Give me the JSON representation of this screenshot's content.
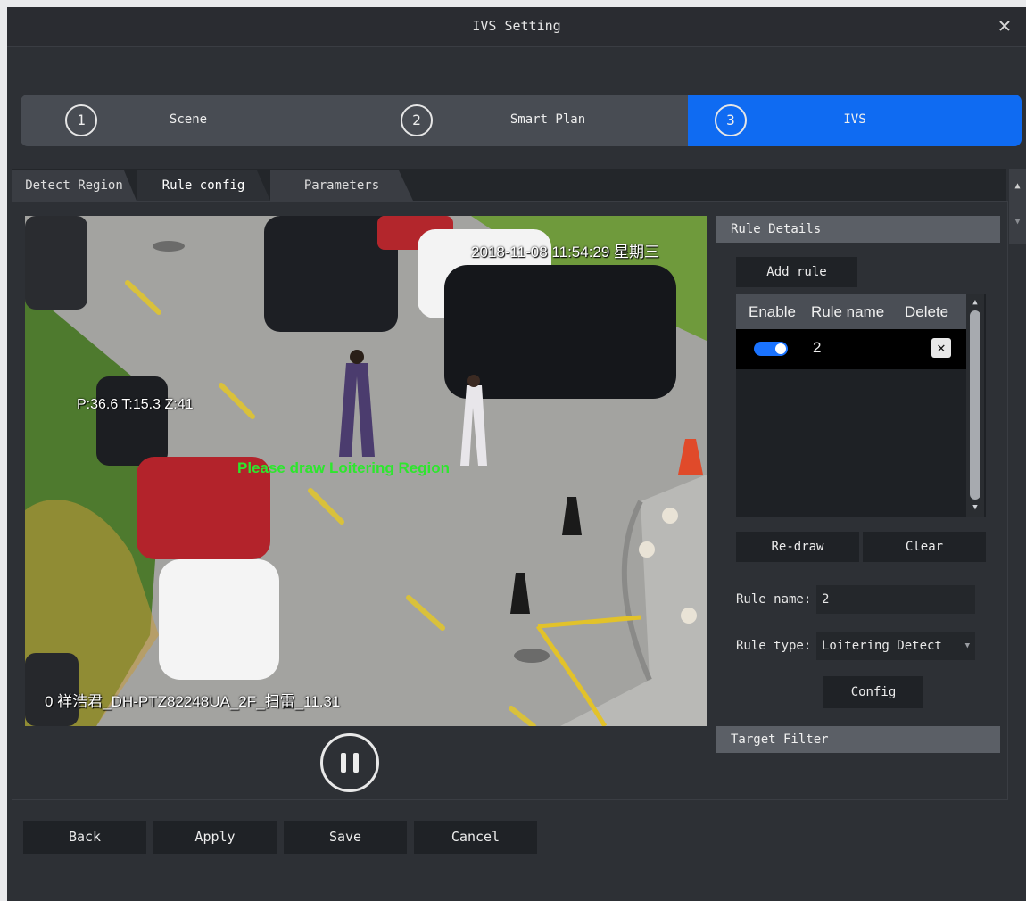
{
  "window": {
    "title": "IVS Setting",
    "close_glyph": "✕"
  },
  "steps": [
    {
      "number": "1",
      "label": "Scene",
      "active": false
    },
    {
      "number": "2",
      "label": "Smart Plan",
      "active": false
    },
    {
      "number": "3",
      "label": "IVS",
      "active": true
    }
  ],
  "tabs": [
    {
      "label": "Detect Region",
      "active": false
    },
    {
      "label": "Rule config",
      "active": true
    },
    {
      "label": "Parameters",
      "active": false
    }
  ],
  "video": {
    "timestamp": "2018-11-08 11:54:29 星期三",
    "ptz_info": "P:36.6 T:15.3 Z:41",
    "channel_name": "0 祥浩君_DH-PTZ82248UA_2F_扫雷_11.31",
    "draw_prompt": "Please draw Loitering Region",
    "prompt_color": "#2ee62e"
  },
  "rule_panel": {
    "header": "Rule Details",
    "add_rule": "Add rule",
    "table": {
      "columns": [
        "Enable",
        "Rule name",
        "Delete"
      ],
      "rows": [
        {
          "enabled": true,
          "name": "2",
          "delete_glyph": "✕"
        }
      ]
    },
    "redraw": "Re-draw",
    "clear": "Clear",
    "rule_name_label": "Rule name:",
    "rule_name_value": "2",
    "rule_type_label": "Rule type:",
    "rule_type_value": "Loitering Detect",
    "config": "Config",
    "target_filter": "Target Filter"
  },
  "footer": {
    "back": "Back",
    "apply": "Apply",
    "save": "Save",
    "cancel": "Cancel"
  },
  "colors": {
    "accent": "#0f6bf2",
    "toggle_on": "#1a73ff"
  }
}
